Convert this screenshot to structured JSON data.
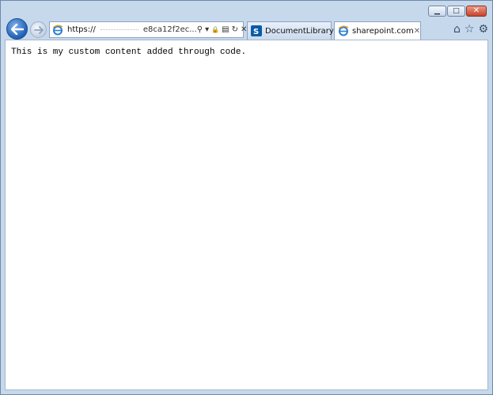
{
  "window": {
    "minimize_glyph": "▁",
    "maximize_glyph": "□",
    "close_glyph": "✕"
  },
  "nav": {
    "address_prefix": "https://",
    "address_hash": "e8ca12f2ec...",
    "search_glyph": "⚲",
    "dropdown_glyph": "▾",
    "lock_glyph": "🔒",
    "compat_glyph": "▤",
    "refresh_glyph": "↻",
    "stop_glyph": "✕"
  },
  "tabs": [
    {
      "label": "DocumentLibrary",
      "active": false,
      "icon": "sharepoint-icon"
    },
    {
      "label": "sharepoint.com",
      "active": true,
      "icon": "ie-icon",
      "close_glyph": "✕"
    }
  ],
  "toolbar_right": {
    "home_glyph": "⌂",
    "favorites_glyph": "☆",
    "tools_glyph": "⚙"
  },
  "page": {
    "body_text": "This is my custom content added through code."
  },
  "colors": {
    "accent": "#1f5fb5",
    "frame": "#c6d8ec",
    "close_red": "#c8412b"
  }
}
